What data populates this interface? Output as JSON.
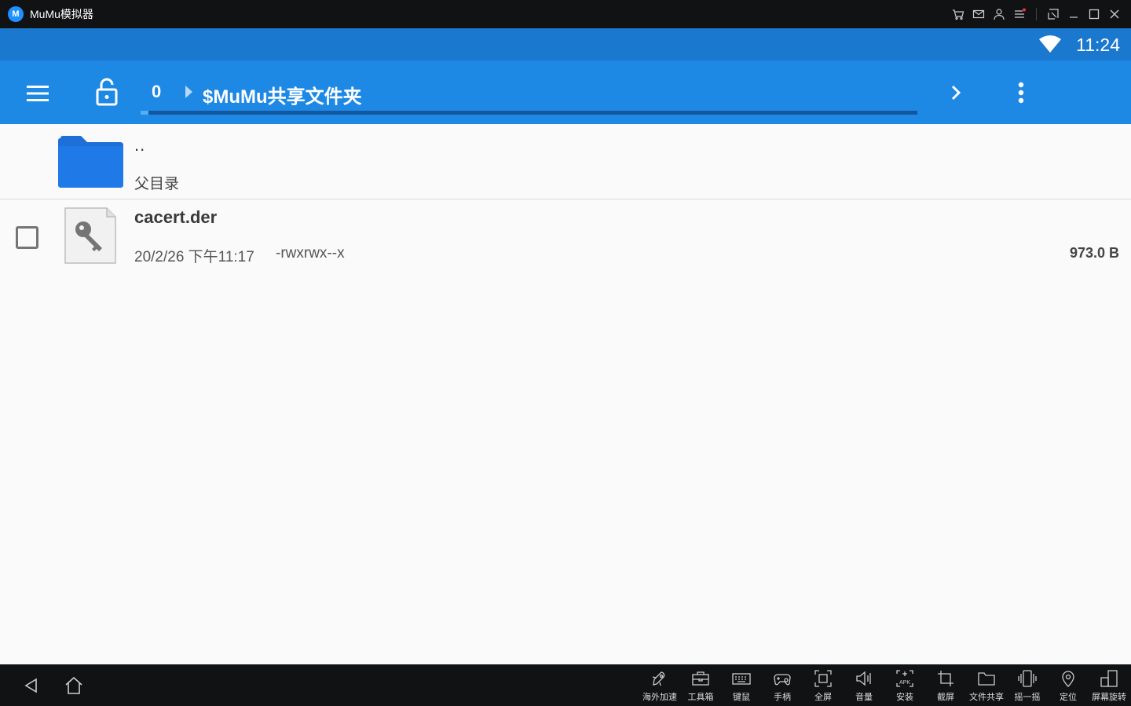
{
  "window": {
    "title": "MuMu模拟器",
    "logo_text": "M"
  },
  "statusbar": {
    "time": "11:24"
  },
  "toolbar": {
    "breadcrumb_root": "0",
    "breadcrumb_current": "$MuMu共享文件夹",
    "progress_fraction": 0.01
  },
  "list": {
    "parent": {
      "name": "..",
      "label": "父目录"
    },
    "files": [
      {
        "name": "cacert.der",
        "date": "20/2/26 下午11:17",
        "permissions": "-rwxrwx--x",
        "size": "973.0 B",
        "checked": false
      }
    ]
  },
  "bottom_tools": [
    {
      "label": "海外加速",
      "icon": "rocket-icon"
    },
    {
      "label": "工具箱",
      "icon": "toolbox-icon"
    },
    {
      "label": "键鼠",
      "icon": "keyboard-icon"
    },
    {
      "label": "手柄",
      "icon": "gamepad-icon"
    },
    {
      "label": "全屏",
      "icon": "fullscreen-icon"
    },
    {
      "label": "音量",
      "icon": "volume-icon"
    },
    {
      "label": "安装",
      "icon": "apk-icon"
    },
    {
      "label": "截屏",
      "icon": "crop-icon"
    },
    {
      "label": "文件共享",
      "icon": "folder-share-icon"
    },
    {
      "label": "摇一摇",
      "icon": "shake-icon"
    },
    {
      "label": "定位",
      "icon": "location-icon"
    },
    {
      "label": "屏幕旋转",
      "icon": "rotate-icon"
    }
  ],
  "colors": {
    "statusbar": "#1a78cf",
    "toolbar": "#1e88e5",
    "folder": "#1e6fd6",
    "titlebar": "#111214"
  }
}
